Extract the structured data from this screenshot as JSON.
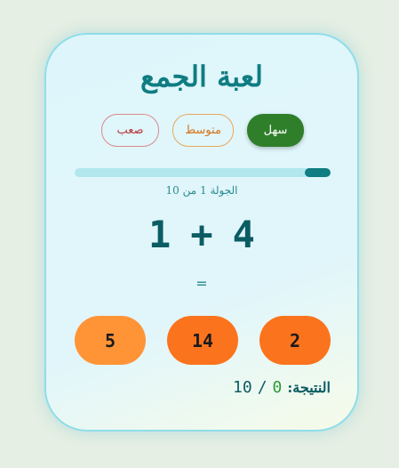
{
  "game": {
    "title": "لعبة الجمع",
    "difficulty": [
      {
        "label": "سهل",
        "selected": true
      },
      {
        "label": "متوسط",
        "selected": false
      },
      {
        "label": "صعب",
        "selected": false
      }
    ],
    "progress_fraction": 0.1,
    "round_label": "الجولة 1 من 10",
    "equation": {
      "a": "1",
      "op": "+",
      "b": "4"
    },
    "equals": "=",
    "answers": [
      "5",
      "14",
      "2"
    ],
    "score": {
      "label": "النتيجة:",
      "value": "0",
      "separator": "/",
      "total": "10"
    }
  },
  "colors": {
    "primary": "#0f7d82",
    "easy": "#2f7f2a",
    "medium": "#d9731a",
    "hard": "#b93a3a",
    "answer": "#fb741d"
  }
}
